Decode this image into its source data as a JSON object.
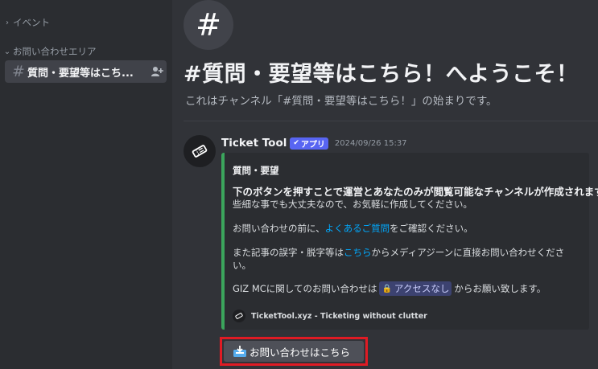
{
  "sidebar": {
    "category_events": "イベント",
    "category_inquiry": "お問い合わせエリア",
    "channel_label": "質問・要望等はこち..."
  },
  "welcome": {
    "hash_glyph": "#",
    "title": "#質問・要望等はこちら！へようこそ！",
    "subtitle": "これはチャンネル「#質問・要望等はこちら！」の始まりです。"
  },
  "message": {
    "author": "Ticket Tool",
    "app_badge": "アプリ",
    "timestamp": "2024/09/26 15:37",
    "embed": {
      "title": "質問・要望",
      "line1": "下のボタンを押すことで運営とあなたのみが閲覧可能なチャンネルが作成されます。",
      "line2": "些細な事でも大丈夫なので、お気軽に作成してください。",
      "line3_pre": "お問い合わせの前に、",
      "line3_link": "よくあるご質問",
      "line3_post": "をご確認ください。",
      "line4_pre": "また記事の誤字・脱字等は",
      "line4_link": "こちら",
      "line4_post": "からメディアジーンに直接お問い合わせくださ",
      "line4_cont": "い。",
      "line5_pre": "GIZ MCに関してのお問い合わせは",
      "line5_chip": "アクセスなし",
      "line5_post": "からお願い致します。",
      "footer": "TicketTool.xyz - Ticketing without clutter"
    },
    "button_label": "お問い合わせはこちら"
  },
  "colors": {
    "embed_accent": "#3ba55c",
    "highlight_box": "#e01b24",
    "link": "#00a8fc",
    "badge": "#5865f2"
  }
}
